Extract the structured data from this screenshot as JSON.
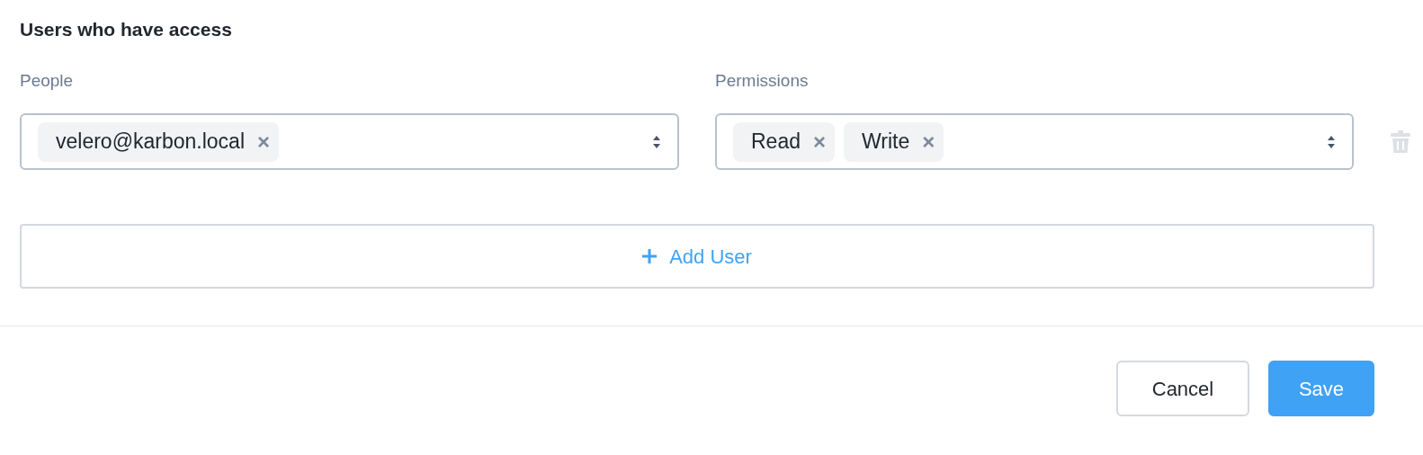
{
  "heading": "Users who have access",
  "columns": [
    {
      "label": "People"
    },
    {
      "label": "Permissions"
    }
  ],
  "rows": [
    {
      "people": [
        {
          "label": "velero@karbon.local",
          "remove": "×"
        }
      ],
      "permissions": [
        {
          "label": "Read",
          "remove": "×"
        },
        {
          "label": "Write",
          "remove": "×"
        }
      ],
      "delete_disabled": true
    }
  ],
  "add_button": {
    "label": "Add User"
  },
  "buttons": [
    {
      "label": "Cancel",
      "kind": "secondary"
    },
    {
      "label": "Save",
      "kind": "primary"
    }
  ]
}
